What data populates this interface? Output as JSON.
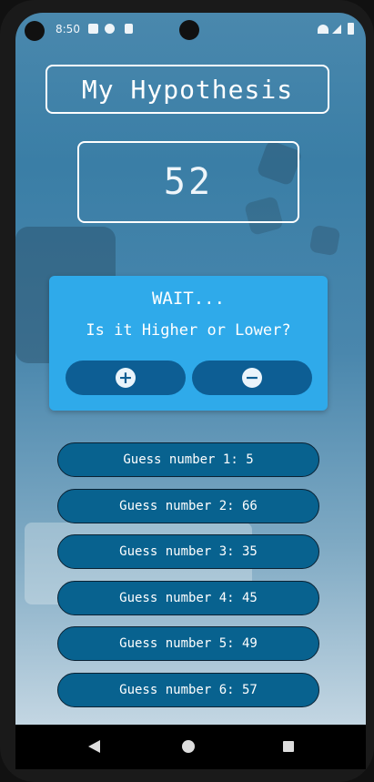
{
  "status_bar": {
    "time": "8:50"
  },
  "app": {
    "title": "My Hypothesis",
    "current_guess": "52",
    "prompt": {
      "heading": "WAIT...",
      "question": "Is it Higher or Lower?",
      "higher_icon": "plus-icon",
      "lower_icon": "minus-icon",
      "higher_symbol": "+",
      "lower_symbol": "−"
    },
    "guesses": [
      "Guess number 1: 5",
      "Guess number 2: 66",
      "Guess number 3: 35",
      "Guess number 4: 45",
      "Guess number 5: 49",
      "Guess number 6: 57"
    ]
  },
  "colors": {
    "accent": "#2faaea",
    "button": "#0d5e94",
    "guess_bg": "#08628f"
  }
}
